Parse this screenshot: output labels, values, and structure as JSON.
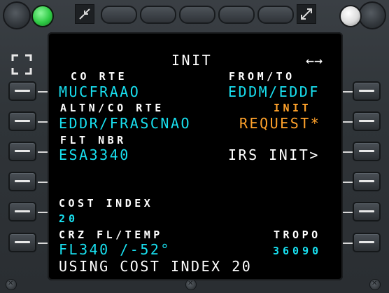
{
  "title": "INIT",
  "page_arrows": "←→",
  "lines": {
    "l1_label": "CO RTE",
    "l1_value": "MUCFRAAO",
    "r1_label": "FROM/TO",
    "r1_value": "EDDM/EDDF",
    "l2_label": "ALTN/CO RTE",
    "l2_value": "EDDR/FRASCNAO",
    "r2_label": "INIT",
    "r2_value": "REQUEST*",
    "l3_label": "FLT NBR",
    "l3_value": "ESA3340",
    "r3_value": "IRS INIT>",
    "l5_label": "COST INDEX",
    "l5_value": "20",
    "l6_label": "CRZ FL/TEMP",
    "l6_value": "FL340 /-52°",
    "r6_label": "TROPO",
    "r6_value": "36090",
    "scratchpad": "USING COST INDEX 20"
  },
  "colors": {
    "label": "#ffffff",
    "data": "#18e0f0",
    "amber": "#ffa22b",
    "fm_lamp": "#35d24a",
    "right_lamp": "#e8e8e8"
  },
  "icons": [
    "expand-arrows-icon",
    "compress-arrows-icon",
    "brightness-knob-icon",
    "screw-icon",
    "fullscreen-frame-icon"
  ]
}
